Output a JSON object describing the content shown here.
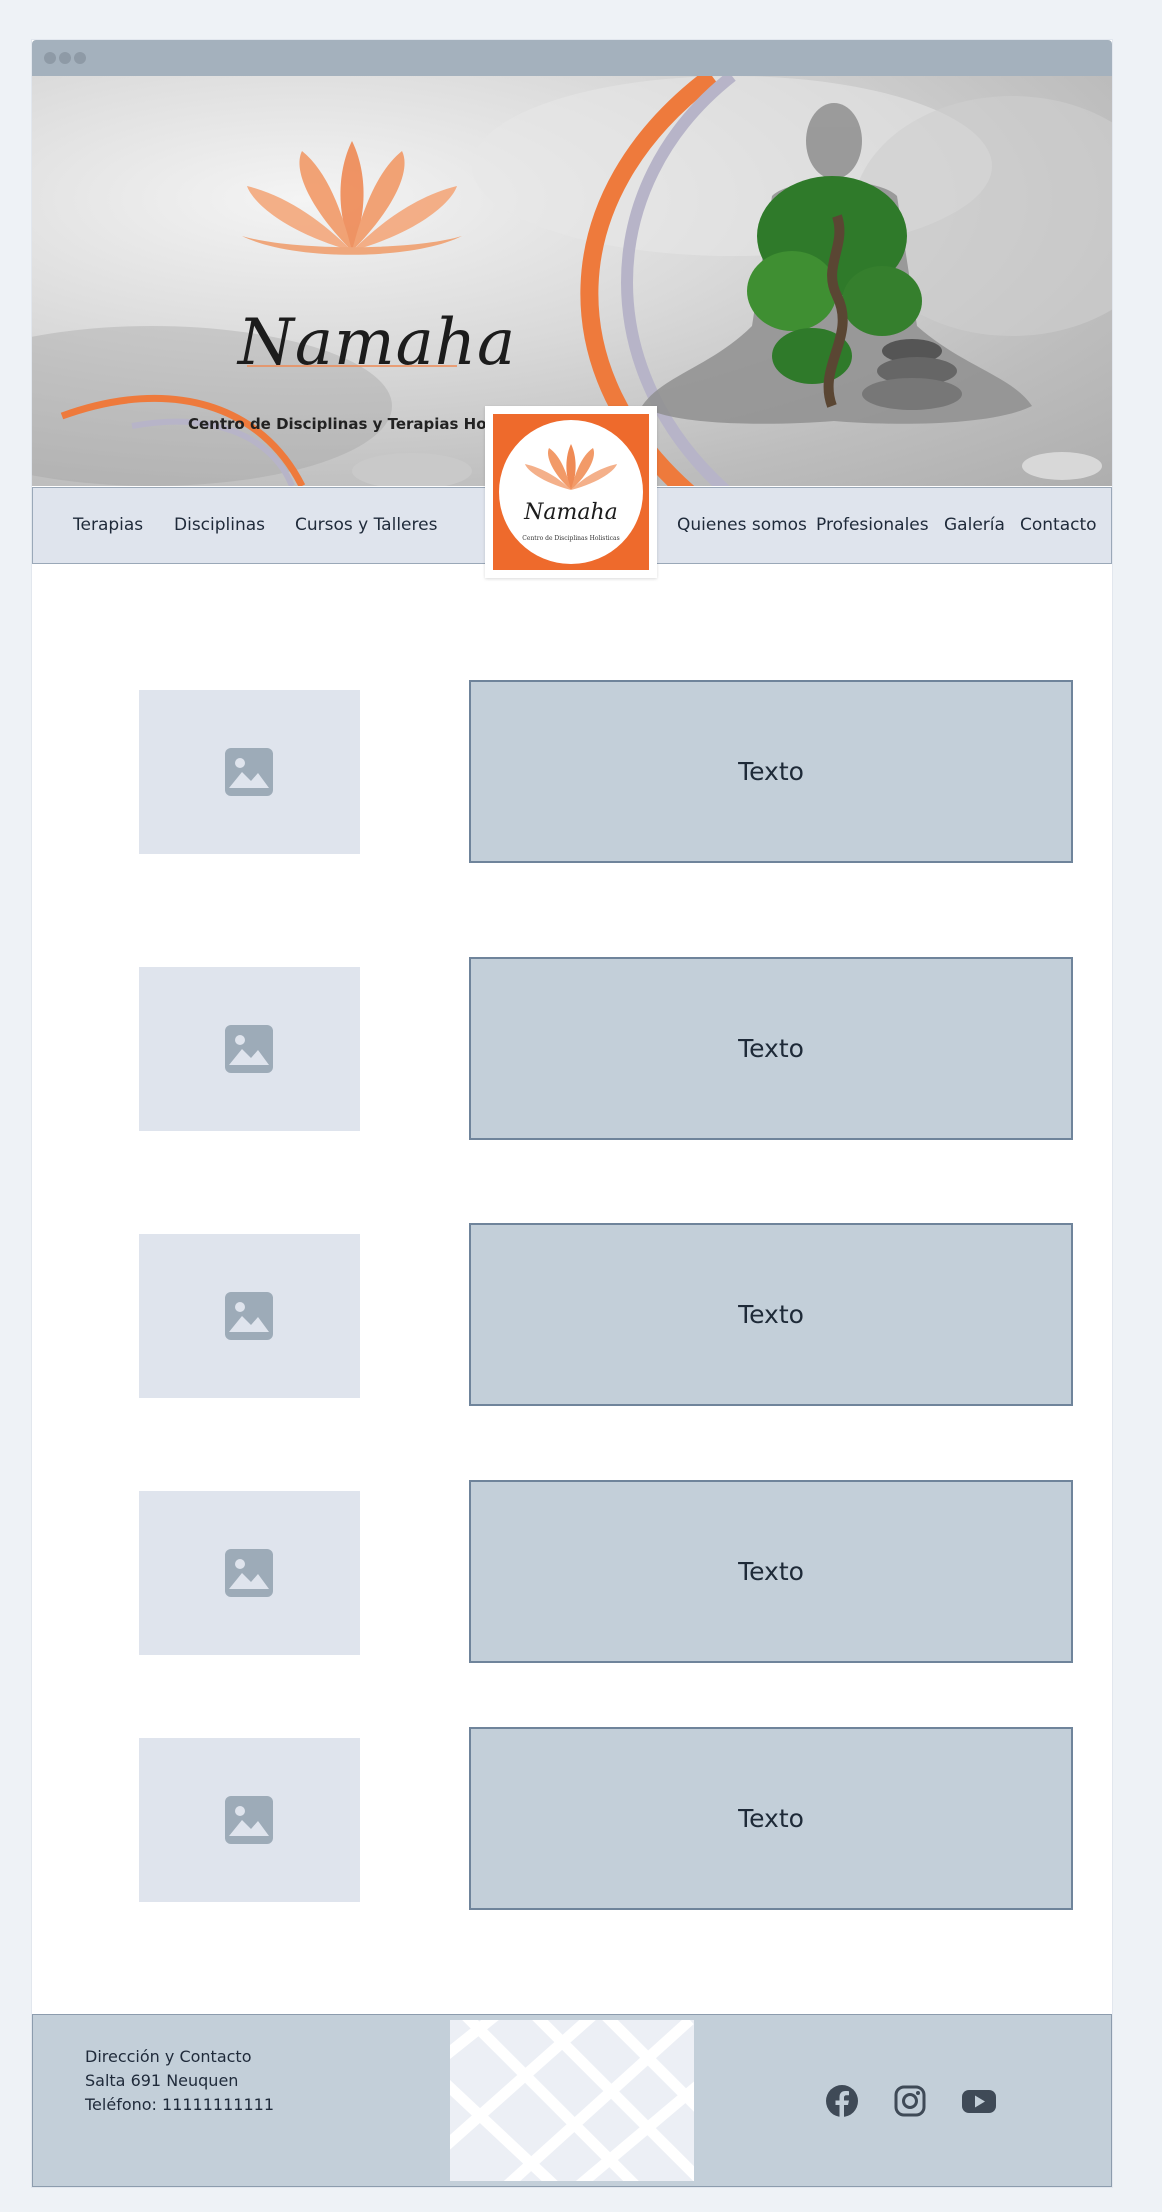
{
  "brand": {
    "name": "Namaha",
    "tagline": "Centro de Disciplinas y Terapias Holisticas",
    "logo_name": "Namaha",
    "logo_tagline": "Centro de Disciplinas Holisticas"
  },
  "nav": {
    "left": [
      "Terapias",
      "Disciplinas",
      "Cursos y Talleres"
    ],
    "right": [
      "Quienes somos",
      "Profesionales",
      "Galería",
      "Contacto"
    ]
  },
  "sections": [
    {
      "image_icon": "image-placeholder-icon",
      "text": "Texto"
    },
    {
      "image_icon": "image-placeholder-icon",
      "text": "Texto"
    },
    {
      "image_icon": "image-placeholder-icon",
      "text": "Texto"
    },
    {
      "image_icon": "image-placeholder-icon",
      "text": "Texto"
    },
    {
      "image_icon": "image-placeholder-icon",
      "text": "Texto"
    }
  ],
  "footer": {
    "contact_title": "Dirección y Contacto",
    "address": "Salta 691 Neuquen",
    "phone": "Teléfono: 11111111111",
    "social": [
      "facebook-icon",
      "instagram-icon",
      "youtube-icon"
    ]
  },
  "colors": {
    "accent_orange": "#ee6a2c",
    "nav_bg": "#dfe4ed",
    "box_bg": "#c3cfd9",
    "box_border": "#6f849b",
    "icon_gray": "#3f4a57"
  }
}
